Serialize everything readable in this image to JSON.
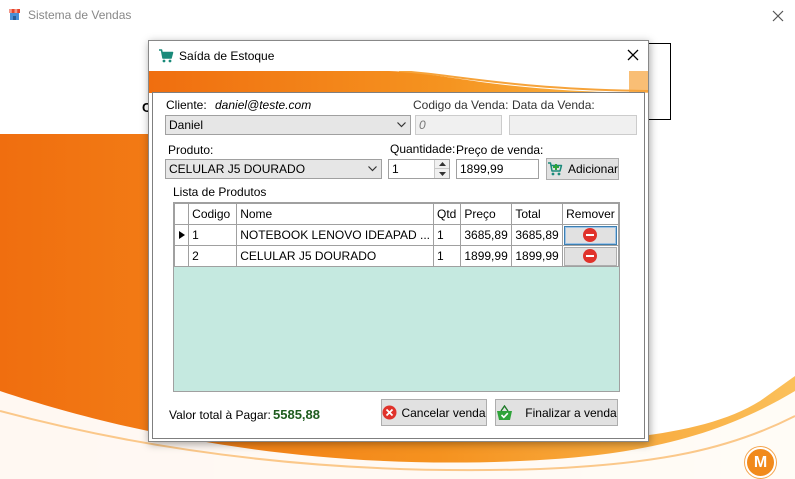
{
  "main_window": {
    "title": "Sistema de Vendas",
    "background_label": "C",
    "logo_letter": "M"
  },
  "dialog": {
    "title": "Saída de Estoque",
    "cliente_label": "Cliente:",
    "cliente_email": "daniel@teste.com",
    "cliente_value": "Daniel",
    "codigo_venda_label": "Codigo da Venda:",
    "codigo_venda_value": "0",
    "data_venda_label": "Data da Venda:",
    "data_venda_value": "",
    "produto_label": "Produto:",
    "produto_value": "CELULAR J5 DOURADO",
    "quantidade_label": "Quantidade:",
    "quantidade_value": "1",
    "preco_label": "Preço de venda:",
    "preco_value": "1899,99",
    "adicionar_label": "Adicionar",
    "lista_label": "Lista de Produtos",
    "grid": {
      "columns": [
        "Codigo",
        "Nome",
        "Qtd",
        "Preço",
        "Total",
        "Remover"
      ],
      "rows": [
        {
          "codigo": "1",
          "nome": "NOTEBOOK LENOVO IDEAPAD ...",
          "qtd": "1",
          "preco": "3685,89",
          "total": "3685,89",
          "selected": true
        },
        {
          "codigo": "2",
          "nome": "CELULAR J5 DOURADO",
          "qtd": "1",
          "preco": "1899,99",
          "total": "1899,99",
          "selected": false
        }
      ]
    },
    "valor_total_label": "Valor total à Pagar:",
    "valor_total_value": "5585,88",
    "cancelar_label": "Cancelar venda",
    "finalizar_label": "Finalizar a venda"
  },
  "colors": {
    "grid_background": "#c5e9e0",
    "brand_orange": "#f18a1c",
    "total_green": "#1e5c1e",
    "remove_red": "#e0322b"
  },
  "icons": [
    "store-icon",
    "close-icon",
    "cart-icon",
    "chevron-down-icon",
    "cart-add-icon",
    "remove-icon",
    "cancel-icon",
    "basket-check-icon",
    "row-pointer-icon"
  ]
}
